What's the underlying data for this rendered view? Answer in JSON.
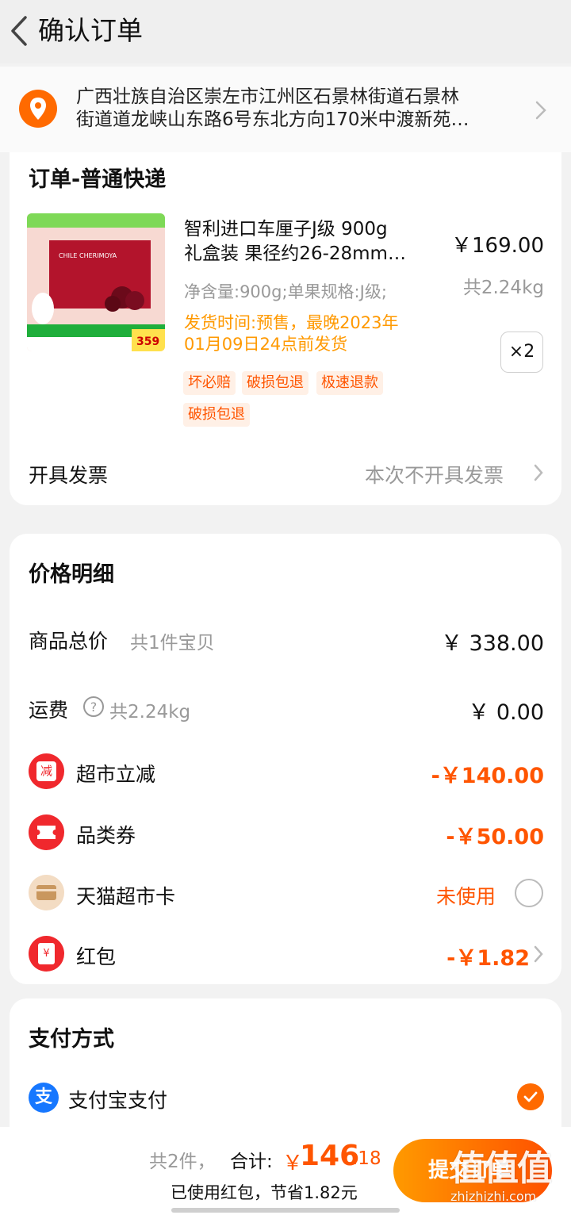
{
  "header": {
    "title": "确认订单"
  },
  "address": {
    "line1": "广西壮族自治区崇左市江州区石景林街道石景林",
    "line2": "街道道龙峡山东路6号东北方向170米中渡新苑…"
  },
  "order": {
    "section_title": "订单-普通快递",
    "product": {
      "title_line1": "智利进口车厘子J级  900g",
      "title_line2": "礼盒装  果径约26-28mm…",
      "unit_price": "￥169.00",
      "weight": "共2.24kg",
      "spec": "净含量:900g;单果规格:J级;",
      "ship_line1": "发货时间:预售，最晚2023年",
      "ship_line2": "01月09日24点前发货",
      "quantity": "×2",
      "thumb_text": "CHILE CHERIMOYA",
      "thumb_price": "359"
    },
    "tags": [
      "坏必赔",
      "破损包退",
      "极速退款",
      "破损包退"
    ],
    "invoice_label": "开具发票",
    "invoice_value": "本次不开具发票"
  },
  "price": {
    "section_title": "价格明细",
    "goods_label": "商品总价",
    "goods_sub": "共1件宝贝",
    "goods_value": "￥ 338.00",
    "freight_label": "运费",
    "freight_sub": "共2.24kg",
    "freight_value": "￥ 0.00",
    "discount_label": "超市立减",
    "discount_icon_text": "减",
    "discount_value": "-￥140.00",
    "coupon_label": "品类券",
    "coupon_value": "-￥50.00",
    "card_label": "天猫超市卡",
    "card_value": "未使用",
    "redpacket_label": "红包",
    "redpacket_icon_text": "¥",
    "redpacket_value": "-￥1.82"
  },
  "payment": {
    "section_title": "支付方式",
    "method": "支付宝支付",
    "method_icon_text": "支"
  },
  "footer": {
    "count": "共2件，",
    "total_label": "合计:",
    "total_symbol": "￥",
    "total_int": "146",
    "total_dec": ".18",
    "saved": "已使用红包，节省1.82元",
    "submit": "提交订单",
    "watermark_logo": "值值值",
    "watermark_url": "zhizhizhi.com"
  },
  "colors": {
    "accent": "#ff5500",
    "orange": "#ff9900",
    "muted": "#999999"
  }
}
